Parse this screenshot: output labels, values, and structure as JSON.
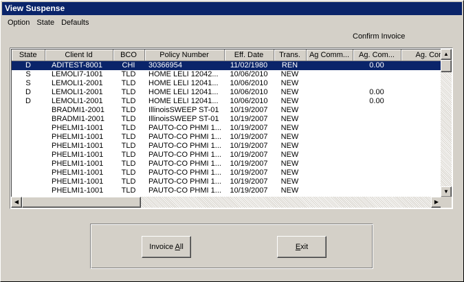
{
  "window": {
    "title": "View Suspense"
  },
  "menu": {
    "items": [
      "Option",
      "State",
      "Defaults"
    ]
  },
  "confirm_label": "Confirm Invoice",
  "grid": {
    "columns": [
      "State",
      "Client Id",
      "BCO",
      "Policy Number",
      "Eff. Date",
      "Trans.",
      "Ag Comm...",
      "Ag. Com...",
      "Ag. Com..."
    ],
    "rows": [
      [
        "D",
        "ADITEST-8001",
        "CHI",
        "30366954",
        "11/02/1980",
        "REN",
        "",
        "0.00",
        ""
      ],
      [
        "S",
        "LEMOLI7-1001",
        "TLD",
        "HOME LELI 12042...",
        "10/06/2010",
        "NEW",
        "",
        "",
        ""
      ],
      [
        "S",
        "LEMOLI1-2001",
        "TLD",
        "HOME LELI 12041...",
        "10/06/2010",
        "NEW",
        "",
        "",
        ""
      ],
      [
        "D",
        "LEMOLI1-2001",
        "TLD",
        "HOME LELI 12041...",
        "10/06/2010",
        "NEW",
        "",
        "0.00",
        ""
      ],
      [
        "D",
        "LEMOLI1-2001",
        "TLD",
        "HOME LELI 12041...",
        "10/06/2010",
        "NEW",
        "",
        "0.00",
        ""
      ],
      [
        "",
        "BRADMI1-2001",
        "TLD",
        "IllinoisSWEEP ST-01",
        "10/19/2007",
        "NEW",
        "",
        "",
        ""
      ],
      [
        "",
        "BRADMI1-2001",
        "TLD",
        "IllinoisSWEEP ST-01",
        "10/19/2007",
        "NEW",
        "",
        "",
        ""
      ],
      [
        "",
        "PHELMI1-1001",
        "TLD",
        "PAUTO-CO PHMI 1...",
        "10/19/2007",
        "NEW",
        "",
        "",
        ""
      ],
      [
        "",
        "PHELMI1-1001",
        "TLD",
        "PAUTO-CO PHMI 1...",
        "10/19/2007",
        "NEW",
        "",
        "",
        ""
      ],
      [
        "",
        "PHELMI1-1001",
        "TLD",
        "PAUTO-CO PHMI 1...",
        "10/19/2007",
        "NEW",
        "",
        "",
        ""
      ],
      [
        "",
        "PHELMI1-1001",
        "TLD",
        "PAUTO-CO PHMI 1...",
        "10/19/2007",
        "NEW",
        "",
        "",
        ""
      ],
      [
        "",
        "PHELMI1-1001",
        "TLD",
        "PAUTO-CO PHMI 1...",
        "10/19/2007",
        "NEW",
        "",
        "",
        ""
      ],
      [
        "",
        "PHELMI1-1001",
        "TLD",
        "PAUTO-CO PHMI 1...",
        "10/19/2007",
        "NEW",
        "",
        "",
        ""
      ],
      [
        "",
        "PHELMI1-1001",
        "TLD",
        "PAUTO-CO PHMI 1...",
        "10/19/2007",
        "NEW",
        "",
        "",
        ""
      ],
      [
        "",
        "PHELMI1-1001",
        "TLD",
        "PAUTO-CO PHMI 1...",
        "10/19/2007",
        "NEW",
        "",
        "",
        ""
      ]
    ],
    "selected_row": 0
  },
  "scrollbars": {
    "up_icon": "arrow-up-icon",
    "down_icon": "arrow-down-icon",
    "left_icon": "arrow-left-icon",
    "right_icon": "arrow-right-icon"
  },
  "buttons": {
    "invoice_all": "Invoice All",
    "exit": "Exit"
  },
  "colors": {
    "titlebar": "#0a246a",
    "selection": "#0a246a",
    "face": "#d4d0c8"
  }
}
